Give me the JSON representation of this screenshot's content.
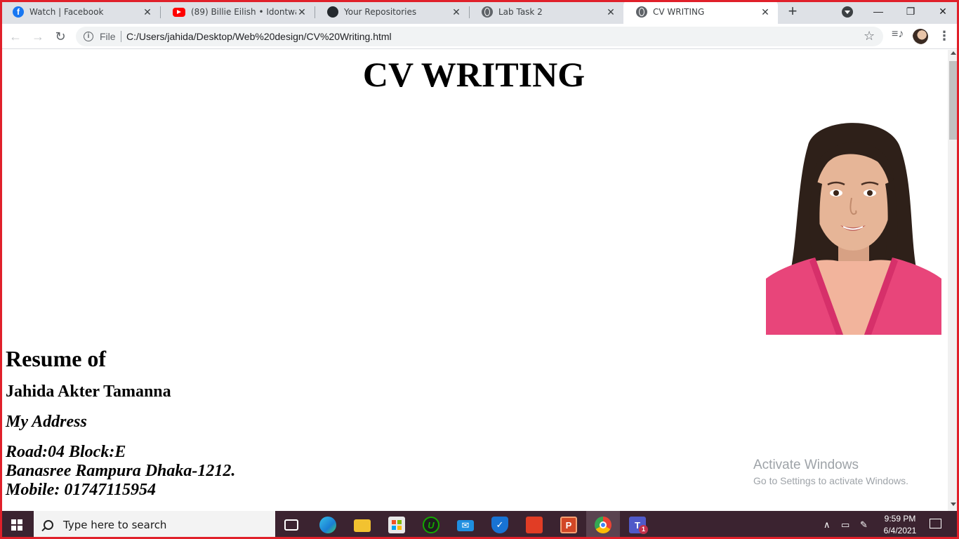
{
  "browser": {
    "tabs": [
      {
        "title": "Watch | Facebook",
        "icon": "facebook-icon"
      },
      {
        "title": "(89) Billie Eilish • Idontwannabeyouanymore",
        "icon": "youtube-icon"
      },
      {
        "title": "Your Repositories",
        "icon": "github-icon"
      },
      {
        "title": "Lab Task 2",
        "icon": "globe-icon"
      },
      {
        "title": "CV WRITING",
        "icon": "globe-icon",
        "active": true
      }
    ],
    "new_tab_label": "+",
    "window_controls": {
      "minimize": "—",
      "restore": "❐",
      "close": "✕"
    },
    "address": {
      "scheme_label": "File",
      "url": "C:/Users/jahida/Desktop/Web%20design/CV%20Writing.html"
    }
  },
  "page": {
    "title": "CV WRITING",
    "resume_heading": "Resume of",
    "name": "Jahida Akter Tamanna",
    "address_heading": "My Address",
    "address_lines": [
      "Road:04 Block:E",
      "Banasree Rampura Dhaka-1212.",
      "Mobile: 01747115954"
    ],
    "photo_alt": "profile photo"
  },
  "watermark": {
    "line1": "Activate Windows",
    "line2": "Go to Settings to activate Windows."
  },
  "taskbar": {
    "search_placeholder": "Type here to search",
    "apps": [
      "task-view-icon",
      "edge-icon",
      "file-explorer-icon",
      "store-icon",
      "upwork-icon",
      "mail-icon",
      "security-icon",
      "office-icon",
      "powerpoint-icon",
      "chrome-icon",
      "teams-icon"
    ],
    "teams_badge": "1",
    "time": "9:59 PM",
    "date": "6/4/2021"
  },
  "colors": {
    "taskbar_bg": "#3b2330",
    "tabstrip_bg": "#dee1e6",
    "frame_border": "#e0202a"
  }
}
